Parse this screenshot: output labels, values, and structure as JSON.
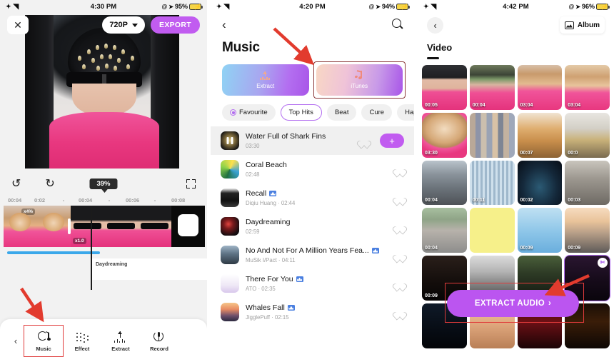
{
  "panel1": {
    "status": {
      "time": "4:30 PM",
      "battery": "95%",
      "wifi_icon": "wifi-icon",
      "location_icon": "location-arrow-icon",
      "at_icon": "at-icon"
    },
    "topbar": {
      "close_icon": "close-icon",
      "resolution": "720P",
      "dropdown_icon": "chevron-down-icon",
      "export_label": "EXPORT"
    },
    "controls": {
      "undo_icon": "undo-icon",
      "redo_icon": "redo-icon",
      "zoom_level": "39%",
      "fullscreen_icon": "fullscreen-icon"
    },
    "ruler_ticks": [
      "00:04",
      "0:02",
      "00:04",
      "00:06",
      "00:08"
    ],
    "clips": [
      {
        "speed_tag": "x4%"
      },
      {
        "speed_tag": "x1.0"
      },
      {
        "speed_tag": ""
      },
      {
        "speed_tag": ""
      }
    ],
    "track_label": "Daydreaming",
    "toolbar": {
      "back_icon": "chevron-left-icon",
      "items": [
        {
          "label": "Music",
          "icon": "music-note-icon",
          "selected": true
        },
        {
          "label": "Effect",
          "icon": "effect-dots-icon",
          "selected": false
        },
        {
          "label": "Extract",
          "icon": "extract-arrow-icon",
          "selected": false
        },
        {
          "label": "Record",
          "icon": "microphone-icon",
          "selected": false
        }
      ]
    }
  },
  "panel2": {
    "status": {
      "time": "4:20 PM",
      "battery": "94%"
    },
    "nav": {
      "back_icon": "chevron-left-icon",
      "search_icon": "search-icon"
    },
    "title": "Music",
    "source_cards": [
      {
        "label": "Extract",
        "icon": "extract-arrow-icon",
        "highlighted": false
      },
      {
        "label": "iTunes",
        "icon": "music-note-icon",
        "highlighted": true
      }
    ],
    "chips": [
      {
        "label": "Favourite",
        "icon": "heart-circle-icon",
        "active": false
      },
      {
        "label": "Top Hits",
        "icon": "",
        "active": true
      },
      {
        "label": "Beat",
        "icon": "",
        "active": false
      },
      {
        "label": "Cure",
        "icon": "",
        "active": false
      },
      {
        "label": "Happ",
        "icon": "",
        "active": false
      }
    ],
    "songs": [
      {
        "title": "Water Full of Shark Fins",
        "sub": "03:30",
        "vip": false,
        "selected": true,
        "add_label": "+",
        "playing_icon": "pause-icon"
      },
      {
        "title": "Coral Beach",
        "sub": "02:48",
        "vip": false,
        "selected": false
      },
      {
        "title": "Recall",
        "sub": "Diqiu Huang · 02:44",
        "vip": true,
        "selected": false
      },
      {
        "title": "Daydreaming",
        "sub": "02:59",
        "vip": false,
        "selected": false
      },
      {
        "title": "No And Not For A Million Years Fea...",
        "sub": "MuSik I/Pact · 04:11",
        "vip": true,
        "selected": false
      },
      {
        "title": "There For You",
        "sub": "ATO · 02:35",
        "vip": true,
        "selected": false
      },
      {
        "title": "Whales Fall",
        "sub": "JigglePuff · 02:15",
        "vip": true,
        "selected": false
      }
    ],
    "heart_icon": "heart-outline-icon"
  },
  "panel3": {
    "status": {
      "time": "4:42 PM",
      "battery": "96%"
    },
    "nav": {
      "back_icon": "chevron-left-icon",
      "album_label": "Album",
      "album_icon": "photo-icon"
    },
    "title": "Video",
    "videos": [
      {
        "duration": "00:05",
        "art": "a-girlhat",
        "selected": false
      },
      {
        "duration": "00:04",
        "art": "a-girlhelm",
        "selected": false
      },
      {
        "duration": "03:04",
        "art": "a-dog",
        "selected": false
      },
      {
        "duration": "03:04",
        "art": "a-dog2",
        "selected": false
      },
      {
        "duration": "03:30",
        "art": "a-dogbig",
        "selected": false
      },
      {
        "duration": "",
        "art": "a-mosaic",
        "selected": false
      },
      {
        "duration": "00:07",
        "art": "a-food",
        "selected": false
      },
      {
        "duration": "00:0",
        "art": "a-desk",
        "selected": false
      },
      {
        "duration": "00:04",
        "art": "a-street",
        "selected": false
      },
      {
        "duration": "00:11",
        "art": "a-curtain",
        "selected": false
      },
      {
        "duration": "00:02",
        "art": "a-night",
        "selected": false
      },
      {
        "duration": "00:03",
        "art": "a-room",
        "selected": false
      },
      {
        "duration": "00:04",
        "art": "a-road",
        "selected": false
      },
      {
        "duration": "",
        "art": "a-yellow",
        "selected": false
      },
      {
        "duration": "00:09",
        "art": "a-sky",
        "selected": false
      },
      {
        "duration": "00:09",
        "art": "a-sunset",
        "selected": false
      },
      {
        "duration": "00:09",
        "art": "a-dark",
        "selected": false
      },
      {
        "duration": "",
        "art": "a-corridor",
        "selected": false
      },
      {
        "duration": "",
        "art": "a-stage",
        "selected": false
      },
      {
        "duration": "",
        "art": "a-purple",
        "selected": true,
        "badge_icon": "cut-icon"
      },
      {
        "duration": "",
        "art": "a-moon",
        "selected": false
      },
      {
        "duration": "",
        "art": "a-skin",
        "selected": false
      },
      {
        "duration": "",
        "art": "a-red",
        "selected": false
      },
      {
        "duration": "",
        "art": "a-fire",
        "selected": false
      }
    ],
    "extract_audio": {
      "label": "EXTRACT AUDIO",
      "chevron": "›"
    }
  },
  "annotations": {
    "arrow_color": "#e23b2e",
    "highlight_color": "#e03b3b"
  }
}
